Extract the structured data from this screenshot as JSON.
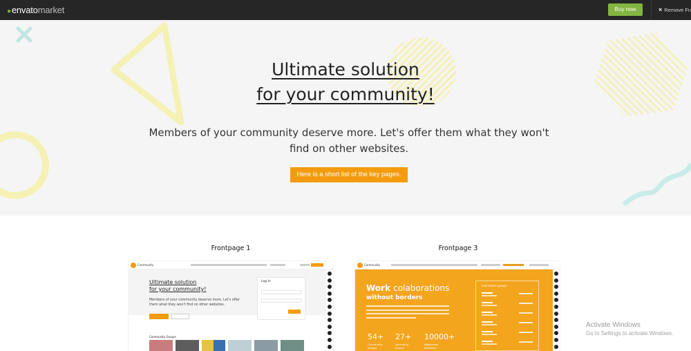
{
  "topbar": {
    "logo_main": "envato",
    "logo_suffix": "market",
    "buy_label": "Buy now",
    "remove_label": "Remove Fra"
  },
  "hero": {
    "title_line1": "Ultimate solution",
    "title_line2": "for your community!",
    "subtitle": "Members of your community deserve more. Let's offer them what they won't find on other websites.",
    "cta_label": "Here is a short list of the key pages."
  },
  "previews": [
    {
      "title": "Frontpage 1",
      "brand": "Community",
      "heading_line1": "Ultimate solution",
      "heading_line2": "for your community!",
      "text": "Members of your community deserve more. Let's offer them what they won't find on other websites.",
      "login_label": "Log In",
      "groups_label": "Community Groups"
    },
    {
      "title": "Frontpage 3",
      "brand": "Community",
      "heading_word1": "Work",
      "heading_word2": "colaborations",
      "heading_line2": "without borders",
      "panel_title": "Last active groups",
      "stats": [
        {
          "value": "54+",
          "label": "Community Groups"
        },
        {
          "value": "27+",
          "label": "Upcoming Events"
        },
        {
          "value": "10000+",
          "label": "Registered Members"
        }
      ]
    }
  ],
  "watermark": {
    "line1": "Activate Windows",
    "line2": "Go to Settings to activate Windows."
  },
  "colors": {
    "accent": "#f39c0f",
    "buy_green": "#82b541",
    "topbar": "#262626"
  }
}
